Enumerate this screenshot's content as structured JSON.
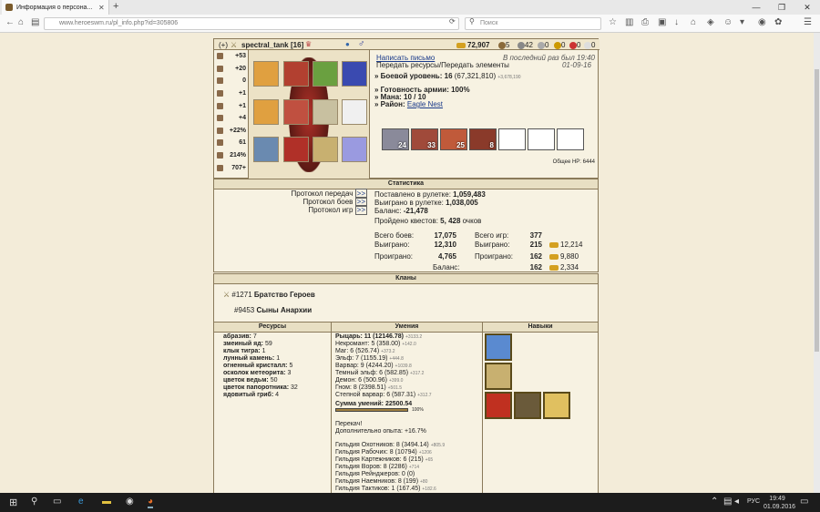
{
  "browser": {
    "tab_title": "Информация о персона...",
    "url": "www.heroeswm.ru/pl_info.php?id=305806",
    "search_placeholder": "Поиск"
  },
  "player": {
    "prefix": "(+)",
    "name": "spectral_tank",
    "level": "[16]",
    "gold": "72,907",
    "wood": "5",
    "ore": "42",
    "res1": "0",
    "res2": "0",
    "res3": "0",
    "res4": "0"
  },
  "stats": [
    {
      "icon": "attack-icon",
      "value": "+53"
    },
    {
      "icon": "defense-icon",
      "value": "+20"
    },
    {
      "icon": "spellpower-icon",
      "value": "0"
    },
    {
      "icon": "knowledge-icon",
      "value": "+1"
    },
    {
      "icon": "luck-icon",
      "value": "+1"
    },
    {
      "icon": "morale-icon",
      "value": "+4"
    },
    {
      "icon": "tool-icon",
      "value": "+22%"
    },
    {
      "icon": "scale-icon",
      "value": "61"
    },
    {
      "icon": "map-icon",
      "value": "214%"
    },
    {
      "icon": "gold-icon",
      "value": "707+"
    }
  ],
  "info": {
    "write": "Написать письмо",
    "transfer": "Передать ресурсы/Передать элементы",
    "lastseen": "В последний раз был 19:40",
    "date": "01-09-16",
    "combat": "» Боевой уровень: 16",
    "combat_exp": "(67,321,810)",
    "combat_small": "+3,678,190",
    "army": "» Готовность армии: 100%",
    "mana": "» Мана: 10 / 10",
    "district_label": "» Район:",
    "district": "Eagle Nest",
    "army_hp": "Общее HP: 6444"
  },
  "units": [
    {
      "count": "24"
    },
    {
      "count": "33"
    },
    {
      "count": "25"
    },
    {
      "count": "8"
    }
  ],
  "statistics": {
    "header": "Статистика",
    "proto_transfer": "Протокол передач",
    "proto_battles": "Протокол боев",
    "proto_games": "Протокол игр",
    "roulette_in": "Поставлено в рулетке:",
    "roulette_in_v": "1,059,483",
    "roulette_won": "Выиграно в рулетке:",
    "roulette_won_v": "1,038,005",
    "balance": "Баланс:",
    "balance_v": "-21,478",
    "quests": "Пройдено квестов:",
    "quests_v": "5, 428",
    "quests_s": "очков",
    "battles": "Всего боев:",
    "battles_v": "17,075",
    "won": "Выиграно:",
    "won_v": "12,310",
    "lost": "Проиграно:",
    "lost_v": "4,765",
    "games": "Всего игр:",
    "games_v": "377",
    "gwon": "Выиграно:",
    "gwon_v": "215",
    "gwon_g": "12,214",
    "glost": "Проиграно:",
    "glost_v": "162",
    "glost_g": "9,880",
    "gbal": "Баланс:",
    "gbal_v": "162",
    "gbal_g": "2,334",
    "arrow": ">>"
  },
  "clans": {
    "header": "Кланы",
    "c1_id": "#1271",
    "c1_name": "Братство Героев",
    "c2_id": "#9453",
    "c2_name": "Сыны Анархии"
  },
  "resources": {
    "header": "Ресурсы",
    "items": [
      {
        "n": "абразив:",
        "v": "7"
      },
      {
        "n": "змеиный яд:",
        "v": "59"
      },
      {
        "n": "клык тигра:",
        "v": "1"
      },
      {
        "n": "лунный камень:",
        "v": "1"
      },
      {
        "n": "огненный кристалл:",
        "v": "5"
      },
      {
        "n": "осколок метеорита:",
        "v": "3"
      },
      {
        "n": "цветок ведьм:",
        "v": "50"
      },
      {
        "n": "цветок папоротника:",
        "v": "32"
      },
      {
        "n": "ядовитый гриб:",
        "v": "4"
      }
    ]
  },
  "abilities": {
    "header": "Умения",
    "items": [
      {
        "t": "Рыцарь: 11 (12146.78)",
        "s": "+3133.2"
      },
      {
        "t": "Некромант: 5 (358.00)",
        "s": "+142.0"
      },
      {
        "t": "Маг: 6 (526.74)",
        "s": "+373.2"
      },
      {
        "t": "Эльф: 7 (1155.19)",
        "s": "+444.8"
      },
      {
        "t": "Варвар: 9 (4244.20)",
        "s": "+1039.8"
      },
      {
        "t": "Темный эльф: 6 (582.85)",
        "s": "+317.2"
      },
      {
        "t": "Демон: 6 (500.96)",
        "s": "+399.0"
      },
      {
        "t": "Гном: 8 (2398.51)",
        "s": "+501.5"
      },
      {
        "t": "Степной варвар: 6 (587.31)",
        "s": "+312.7"
      }
    ],
    "sum": "Сумма умений: 22500.54",
    "pct": "100%",
    "perek": "Перекач!",
    "extra": "Дополнительно опыта: +16.7%",
    "guilds": [
      {
        "t": "Гильдия Охотников: 8 (3494.14)",
        "s": "+805.9"
      },
      {
        "t": "Гильдия Рабочих: 8 (10794)",
        "s": "+1206"
      },
      {
        "t": "Гильдия Картежников: 6 (215)",
        "s": "+65"
      },
      {
        "t": "Гильдия Воров: 8 (2286)",
        "s": "+714"
      },
      {
        "t": "Гильдия Рейнджеров: 0 (0)",
        "s": ""
      },
      {
        "t": "Гильдия Наемников: 8 (199)",
        "s": "+80"
      },
      {
        "t": "Гильдия Тактиков: 1 (167.45)",
        "s": "+182.6"
      }
    ]
  },
  "skills": {
    "header": "Навыки"
  },
  "taskbar": {
    "time": "19:49",
    "date": "01.09.2016",
    "lang": "РУС"
  }
}
